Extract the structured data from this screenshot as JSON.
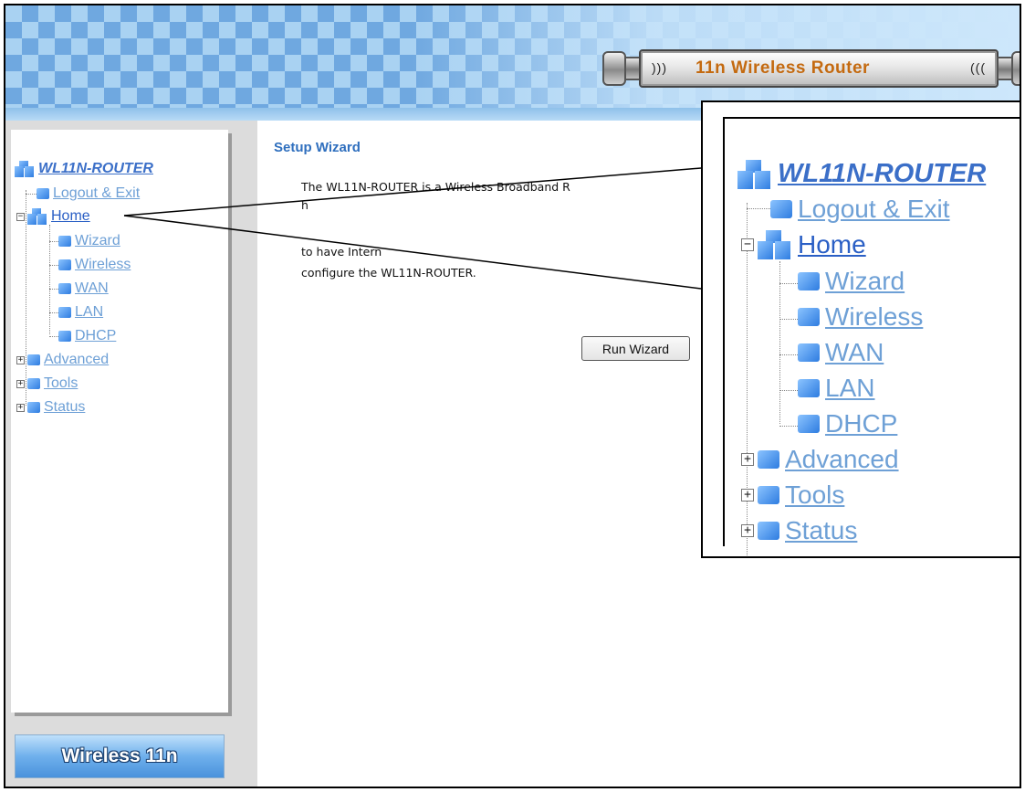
{
  "banner": {
    "title": "11n Wireless Router",
    "waves_left": ")))",
    "waves_right": "((("
  },
  "nav": {
    "root": "WL11N-ROUTER",
    "logout": "Logout & Exit",
    "home": "Home",
    "home_toggle": "−",
    "home_children": [
      "Wizard",
      "Wireless",
      "WAN",
      "LAN",
      "DHCP"
    ],
    "collapsed": [
      {
        "label": "Advanced",
        "toggle": "+"
      },
      {
        "label": "Tools",
        "toggle": "+"
      },
      {
        "label": "Status",
        "toggle": "+"
      }
    ]
  },
  "footer_button": {
    "label": "Wireless 11n"
  },
  "main": {
    "title": "Setup Wizard",
    "lines": [
      "The WL11N-ROUTER is a Wireless Broadband R",
      "h",
      "to have Intern",
      "configure the WL11N-ROUTER."
    ],
    "button": "Run Wizard"
  }
}
